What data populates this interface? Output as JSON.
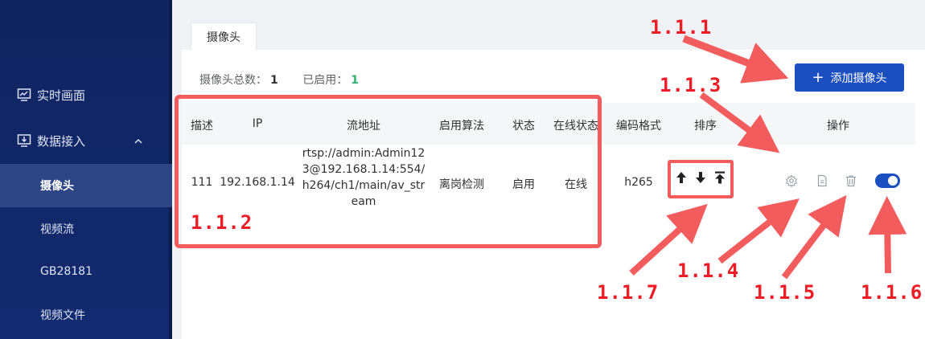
{
  "sidebar": {
    "items": [
      {
        "label": "实时画面",
        "icon": "chart-monitor-icon"
      },
      {
        "label": "数据接入",
        "icon": "monitor-download-icon",
        "expanded": true
      },
      {
        "label": "摄像头",
        "active": true
      },
      {
        "label": "视频流"
      },
      {
        "label": "GB28181"
      },
      {
        "label": "视频文件"
      }
    ]
  },
  "tabs": [
    {
      "label": "摄像头"
    }
  ],
  "stats": {
    "total_label": "摄像头总数：",
    "total_value": "1",
    "enabled_label": "已启用：",
    "enabled_value": "1"
  },
  "add_button": {
    "label": "添加摄像头",
    "icon": "plus-icon"
  },
  "table": {
    "headers": [
      "描述",
      "IP",
      "流地址",
      "启用算法",
      "状态",
      "在线状态",
      "编码格式",
      "排序",
      "操作"
    ],
    "rows": [
      {
        "desc": "111",
        "ip": "192.168.1.14",
        "url": "rtsp://admin:Admin123@192.168.1.14:554/h264/ch1/main/av_stream",
        "algorithm": "离岗检测",
        "status": "启用",
        "online": "在线",
        "codec": "h265",
        "sort_icons": [
          "arrow-up-icon",
          "arrow-down-icon",
          "arrow-top-icon"
        ],
        "action_icons": [
          "settings-icon",
          "document-icon",
          "trash-icon",
          "toggle-switch"
        ],
        "enabled": true
      }
    ]
  },
  "annotations": {
    "l111": "1.1.1",
    "l112": "1.1.2",
    "l113": "1.1.3",
    "l114": "1.1.4",
    "l115": "1.1.5",
    "l116": "1.1.6",
    "l117": "1.1.7"
  },
  "colors": {
    "sidebar": "#0f2460",
    "primary": "#1b4fbf",
    "success": "#2fb36b",
    "annotation": "#ee1c25"
  }
}
